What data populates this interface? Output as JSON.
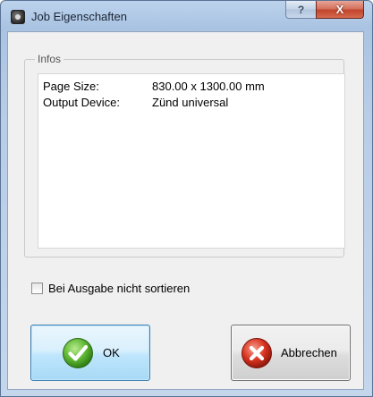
{
  "window": {
    "title": "Job Eigenschaften",
    "help_glyph": "?",
    "close_glyph": "X"
  },
  "infos": {
    "legend": "Infos",
    "rows": [
      {
        "key": "Page Size:",
        "value": "830.00 x 1300.00 mm"
      },
      {
        "key": "Output Device:",
        "value": "Zünd universal"
      }
    ]
  },
  "options": {
    "no_sort_label": "Bei Ausgabe nicht sortieren",
    "no_sort_checked": false
  },
  "buttons": {
    "ok_label": "OK",
    "cancel_label": "Abbrechen"
  },
  "colors": {
    "ok_icon": "#5cb531",
    "cancel_icon": "#d9321f",
    "ok_button_border": "#3c7fb1"
  },
  "icons": {
    "app": "app-icon",
    "ok": "checkmark-icon",
    "cancel": "cross-icon"
  }
}
